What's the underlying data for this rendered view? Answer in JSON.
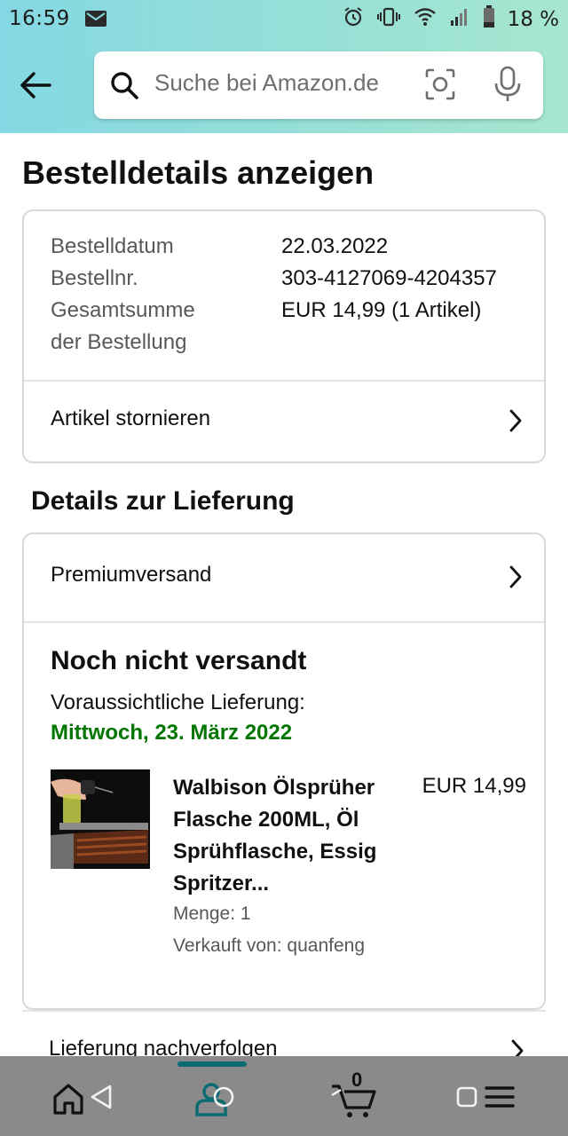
{
  "status_bar": {
    "time": "16:59",
    "battery": "18 %"
  },
  "search": {
    "placeholder": "Suche bei Amazon.de"
  },
  "page": {
    "title": "Bestelldetails anzeigen"
  },
  "order_summary": {
    "date_label": "Bestelldatum",
    "date_value": "22.03.2022",
    "number_label": "Bestellnr.",
    "number_value": "303-4127069-4204357",
    "total_label_line1": "Gesamtsumme",
    "total_label_line2": "der Bestellung",
    "total_value": "EUR 14,99 (1 Artikel)",
    "cancel_label": "Artikel stornieren"
  },
  "delivery": {
    "section_title": "Details zur Lieferung",
    "shipping_method": "Premiumversand",
    "status": "Noch nicht versandt",
    "expected_label": "Voraussichtliche Lieferung:",
    "expected_date": "Mittwoch, 23. März 2022",
    "accent_color": "#007600"
  },
  "product": {
    "title": "Walbison Ölsprüher Flasche 200ML, Öl Sprühflasche, Essig Spritzer...",
    "price": "EUR 14,99",
    "quantity": "Menge: 1",
    "seller": "Verkauft von: quanfeng"
  },
  "track": {
    "label": "Lieferung nachverfolgen"
  },
  "bottom_nav": {
    "cart_count": "0",
    "items": [
      "home-icon",
      "account-icon",
      "cart-icon",
      "menu-icon"
    ],
    "active_color": "#0b6b72"
  }
}
